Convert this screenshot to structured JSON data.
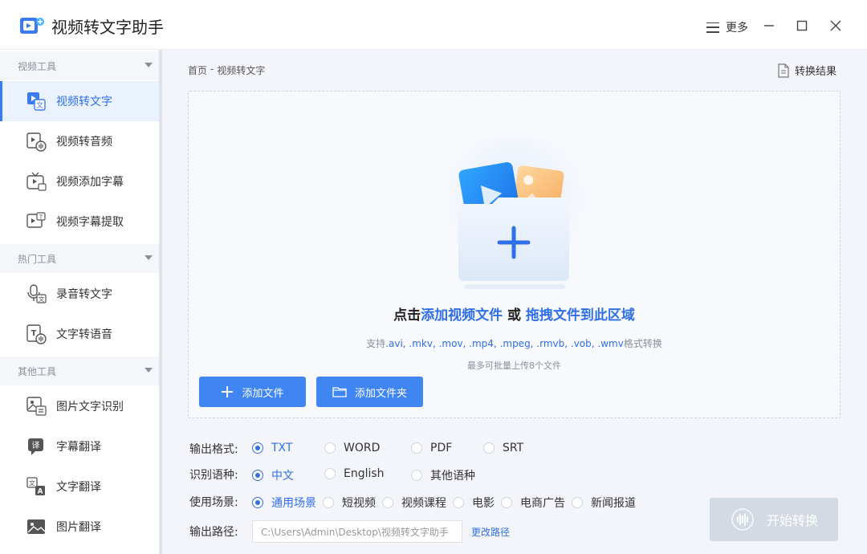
{
  "app": {
    "title": "视频转文字助手"
  },
  "window": {
    "more_label": "更多"
  },
  "sidebar": {
    "sections": [
      {
        "title": "视频工具",
        "items": [
          {
            "label": "视频转文字",
            "icon": "video-to-text-icon",
            "active": true
          },
          {
            "label": "视频转音频",
            "icon": "video-to-audio-icon"
          },
          {
            "label": "视频添加字幕",
            "icon": "video-subtitle-add-icon"
          },
          {
            "label": "视频字幕提取",
            "icon": "video-subtitle-extract-icon"
          }
        ]
      },
      {
        "title": "热门工具",
        "items": [
          {
            "label": "录音转文字",
            "icon": "microphone-text-icon"
          },
          {
            "label": "文字转语音",
            "icon": "text-to-speech-icon"
          }
        ]
      },
      {
        "title": "其他工具",
        "items": [
          {
            "label": "图片文字识别",
            "icon": "image-ocr-icon"
          },
          {
            "label": "字幕翻译",
            "icon": "subtitle-translate-icon"
          },
          {
            "label": "文字翻译",
            "icon": "text-translate-icon"
          },
          {
            "label": "图片翻译",
            "icon": "image-translate-icon"
          }
        ]
      }
    ]
  },
  "breadcrumb": {
    "home": "首页",
    "separator": "-",
    "current": "视频转文字"
  },
  "result_button": {
    "label": "转换结果"
  },
  "dropzone": {
    "prefix": "点击",
    "link1": "添加视频文件",
    "middle": " 或 ",
    "link2": "拖拽文件到此区域",
    "support_prefix": "支持",
    "support_formats": ".avi, .mkv, .mov, .mp4, .mpeg, .rmvb, .vob, .wmv",
    "support_suffix": "格式转换",
    "limit": "最多可批量上传8个文件",
    "add_file": "添加文件",
    "add_folder": "添加文件夹"
  },
  "options": {
    "format": {
      "label": "输出格式:",
      "choices": [
        "TXT",
        "WORD",
        "PDF",
        "SRT"
      ],
      "selected": "TXT"
    },
    "language": {
      "label": "识别语种:",
      "choices": [
        "中文",
        "English",
        "其他语种"
      ],
      "selected": "中文"
    },
    "scene": {
      "label": "使用场景:",
      "choices": [
        "通用场景",
        "短视频",
        "视频课程",
        "电影",
        "电商广告",
        "新闻报道"
      ],
      "selected": "通用场景"
    },
    "path": {
      "label": "输出路径:",
      "value": "C:\\Users\\Admin\\Desktop\\视频转文字助手",
      "change_label": "更改路径"
    }
  },
  "start_button": {
    "label": "开始转换"
  },
  "colors": {
    "accent": "#2f6fe8",
    "button": "#3f86f3",
    "disabled": "#d4dae3"
  }
}
